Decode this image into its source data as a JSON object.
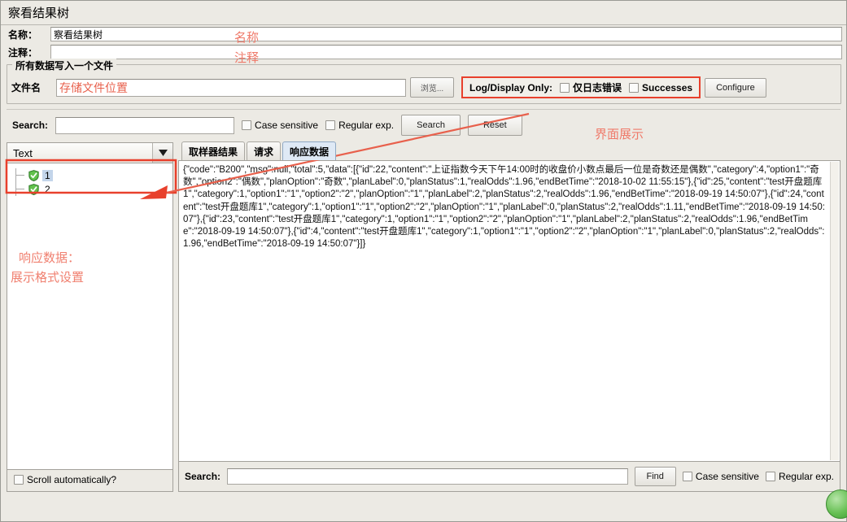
{
  "window": {
    "title": "察看结果树"
  },
  "fields": {
    "name_label": "名称：",
    "name_value": "察看结果树",
    "comment_label": "注释：",
    "comment_value": "",
    "name_annotation": "名称",
    "comment_annotation": "注释"
  },
  "filegroup": {
    "title": "所有数据写入一个文件",
    "filename_label": "文件名",
    "filename_value": "存储文件位置",
    "browse_button": "浏览...",
    "log_display_caption": "Log/Display Only:",
    "errors_only_label": "仅日志错误",
    "successes_label": "Successes",
    "configure_button": "Configure",
    "ui_annotation": "界面展示"
  },
  "search_top": {
    "label": "Search:",
    "value": "",
    "case_sensitive": "Case sensitive",
    "regular_exp": "Regular exp.",
    "search_button": "Search",
    "reset_button": "Reset"
  },
  "left_panel": {
    "renderer_selected": "Text",
    "renderer_options": [
      "Text"
    ],
    "tree_nodes": [
      {
        "label": "1",
        "selected": true
      },
      {
        "label": "2",
        "selected": false
      }
    ],
    "scroll_auto_label": "Scroll automatically?",
    "annotation_line1": "响应数据：",
    "annotation_line2": "展示格式设置"
  },
  "right_panel": {
    "tabs": [
      {
        "label": "取样器结果",
        "active": false
      },
      {
        "label": "请求",
        "active": false
      },
      {
        "label": "响应数据",
        "active": true
      }
    ],
    "response_text": "{\"code\":\"B200\",\"msg\":null,\"total\":5,\"data\":[{\"id\":22,\"content\":\"上证指数今天下午14:00时的收盘价小数点最后一位是奇数还是偶数\",\"category\":4,\"option1\":\"奇数\",\"option2\":\"偶数\",\"planOption\":\"奇数\",\"planLabel\":0,\"planStatus\":1,\"realOdds\":1.96,\"endBetTime\":\"2018-10-02 11:55:15\"},{\"id\":25,\"content\":\"test开盘题库1\",\"category\":1,\"option1\":\"1\",\"option2\":\"2\",\"planOption\":\"1\",\"planLabel\":2,\"planStatus\":2,\"realOdds\":1.96,\"endBetTime\":\"2018-09-19 14:50:07\"},{\"id\":24,\"content\":\"test开盘题库1\",\"category\":1,\"option1\":\"1\",\"option2\":\"2\",\"planOption\":\"1\",\"planLabel\":0,\"planStatus\":2,\"realOdds\":1.11,\"endBetTime\":\"2018-09-19 14:50:07\"},{\"id\":23,\"content\":\"test开盘题库1\",\"category\":1,\"option1\":\"1\",\"option2\":\"2\",\"planOption\":\"1\",\"planLabel\":2,\"planStatus\":2,\"realOdds\":1.96,\"endBetTime\":\"2018-09-19 14:50:07\"},{\"id\":4,\"content\":\"test开盘题库1\",\"category\":1,\"option1\":\"1\",\"option2\":\"2\",\"planOption\":\"1\",\"planLabel\":0,\"planStatus\":2,\"realOdds\":1.96,\"endBetTime\":\"2018-09-19 14:50:07\"}]}"
  },
  "search_bottom": {
    "label": "Search:",
    "value": "",
    "find_button": "Find",
    "case_sensitive": "Case sensitive",
    "regular_exp": "Regular exp."
  },
  "colors": {
    "annotation_red": "#ef7a6a",
    "highlight_box_red": "#e8402c",
    "tab_active_blue": "#dfe9f5",
    "node_selected_blue": "#c3d5ea",
    "status_green": "#3f9b34"
  },
  "icons": {
    "dropdown": "chevron-down-icon",
    "node_status": "green-shield-check-icon",
    "status_indicator": "green-circle-icon"
  }
}
